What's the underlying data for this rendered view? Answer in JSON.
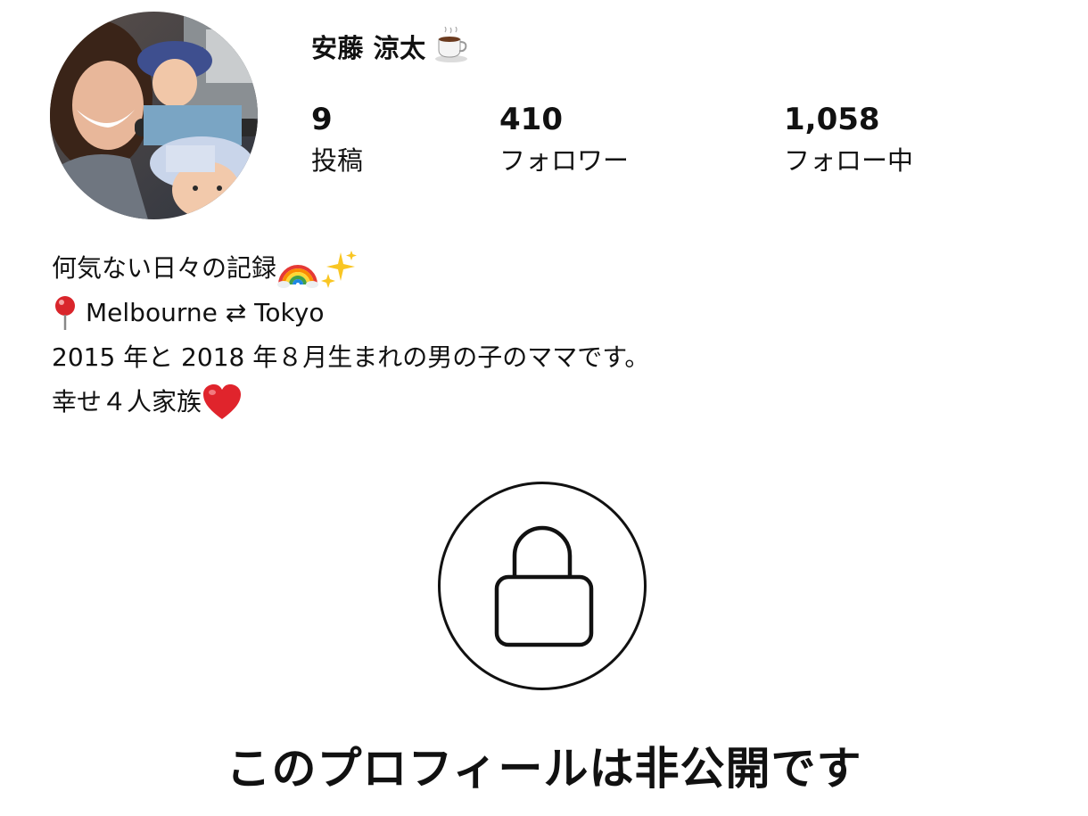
{
  "profile": {
    "username": "安藤 涼太",
    "username_icon": "coffee-icon"
  },
  "stats": {
    "posts": {
      "count": "9",
      "label": "投稿"
    },
    "followers": {
      "count": "410",
      "label": "フォロワー"
    },
    "following": {
      "count": "1,058",
      "label": "フォロー中"
    }
  },
  "bio": {
    "line1_text": "何気ない日々の記録 ",
    "line1_icons": [
      "rainbow-icon",
      "sparkles-icon"
    ],
    "line2_location": "Melbourne ⇄ Tokyo",
    "line2_icon": "pin-icon",
    "line3_text": "2015 年と 2018 年８月生まれの男の子のママです。",
    "line4_text": "幸せ４人家族",
    "line4_icon": "heart-icon"
  },
  "private_notice": {
    "icon": "lock-icon",
    "text": "このプロフィールは非公開です"
  },
  "colors": {
    "text": "#111111",
    "background": "#ffffff",
    "heart": "#e0242c",
    "pin": "#d9252b"
  }
}
